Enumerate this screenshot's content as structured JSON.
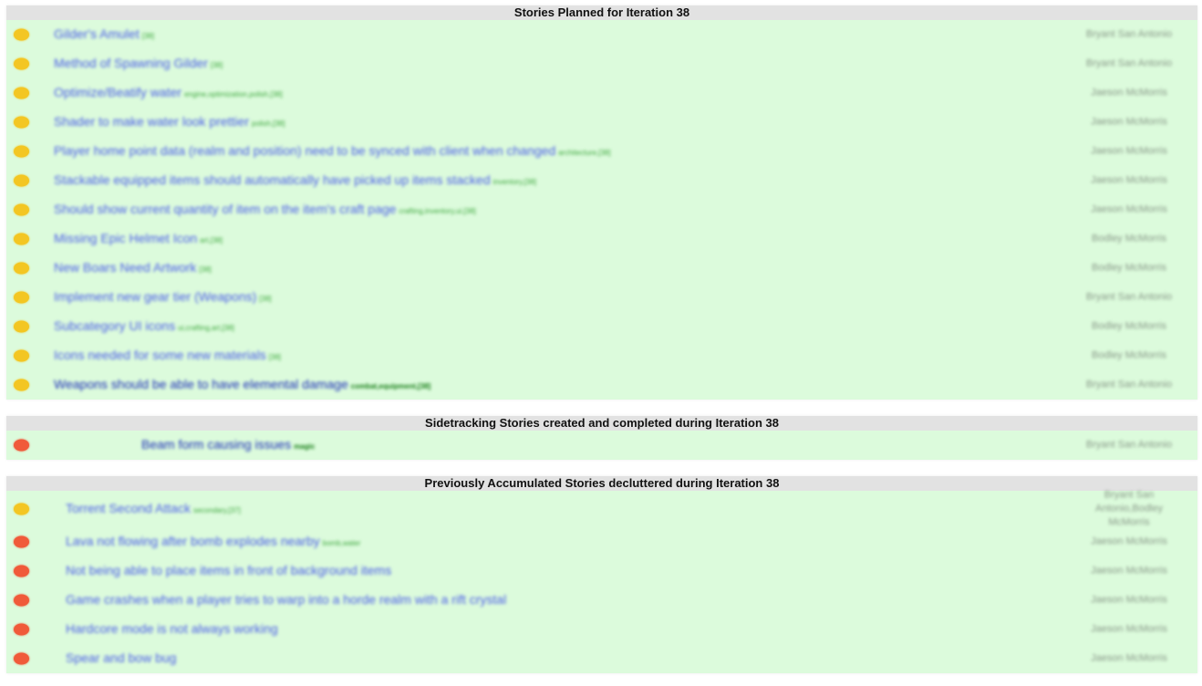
{
  "sections": [
    {
      "title": "Stories Planned for Iteration 38",
      "stories": [
        {
          "status": "yellow",
          "title": "Gilder's Amulet",
          "tags": "[38]",
          "owner": "Bryant San Antonio"
        },
        {
          "status": "yellow",
          "title": "Method of Spawning Gilder",
          "tags": "[38]",
          "owner": "Bryant San Antonio"
        },
        {
          "status": "yellow",
          "title": "Optimize/Beatify water",
          "tags": "engine,optimization,polish,[38]",
          "owner": "Jaeson McMorris"
        },
        {
          "status": "yellow",
          "title": "Shader to make water look prettier",
          "tags": "polish,[38]",
          "owner": "Jaeson McMorris"
        },
        {
          "status": "yellow",
          "title": "Player home point data (realm and position) need to be synced with client when changed",
          "tags": "architecture,[38]",
          "owner": "Jaeson McMorris"
        },
        {
          "status": "yellow",
          "title": "Stackable equipped items should automatically have picked up items stacked",
          "tags": "inventory,[38]",
          "owner": "Jaeson McMorris"
        },
        {
          "status": "yellow",
          "title": "Should show current quantity of item on the item's craft page",
          "tags": "crafting,inventory,ui,[38]",
          "owner": "Jaeson McMorris"
        },
        {
          "status": "yellow",
          "title": "Missing Epic Helmet Icon",
          "tags": "art,[38]",
          "owner": "Bodley McMorris"
        },
        {
          "status": "yellow",
          "title": "New Boars Need Artwork",
          "tags": "[38]",
          "owner": "Bodley McMorris"
        },
        {
          "status": "yellow",
          "title": "Implement new gear tier (Weapons)",
          "tags": "[38]",
          "owner": "Bryant San Antonio"
        },
        {
          "status": "yellow",
          "title": "Subcategory UI icons",
          "tags": "ui,crafting,art,[38]",
          "owner": "Bodley McMorris"
        },
        {
          "status": "yellow",
          "title": "Icons needed for some new materials",
          "tags": "[38]",
          "owner": "Bodley McMorris"
        },
        {
          "status": "yellow",
          "title": "Weapons should be able to have elemental damage",
          "tags": "combat,equipment,[38]",
          "owner": "Bryant San Antonio",
          "sharp": true
        }
      ]
    },
    {
      "title": "Sidetracking Stories created and completed during Iteration 38",
      "stories": [
        {
          "status": "red",
          "title": "Beam form causing issues",
          "tags": "magic",
          "owner": "Bryant San Antonio",
          "sharp": true
        }
      ]
    },
    {
      "title": "Previously Accumulated Stories decluttered during Iteration 38",
      "stories": [
        {
          "status": "yellow",
          "title": "Torrent Second Attack",
          "tags": "secondary,[37]",
          "owner": "Bryant San Antonio,Bodley McMorris"
        },
        {
          "status": "red",
          "title": "Lava not flowing after bomb explodes nearby",
          "tags": "bomb,water",
          "owner": "Jaeson McMorris"
        },
        {
          "status": "red",
          "title": "Not being able to place items in front of background items",
          "tags": "",
          "owner": "Jaeson McMorris"
        },
        {
          "status": "red",
          "title": "Game crashes when a player tries to warp into a horde realm with a rift crystal",
          "tags": "",
          "owner": "Jaeson McMorris"
        },
        {
          "status": "red",
          "title": "Hardcore mode is not always working",
          "tags": "",
          "owner": "Jaeson McMorris"
        },
        {
          "status": "red",
          "title": "Spear and bow bug",
          "tags": "",
          "owner": "Jaeson McMorris"
        }
      ]
    }
  ],
  "colors": {
    "section_background": "#dcfbdc",
    "header_background": "#e2e2e2",
    "status_yellow": "#f3c623",
    "status_red": "#f05a3a",
    "link": "#4d5fe8",
    "tag": "#3fa83f"
  }
}
